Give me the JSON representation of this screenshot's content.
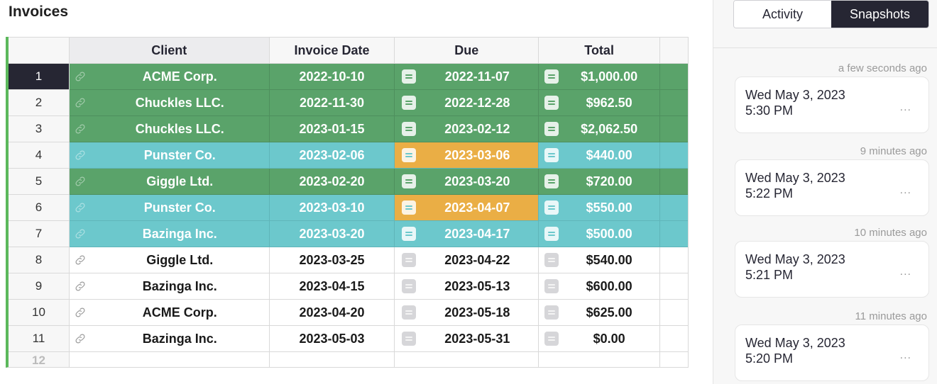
{
  "page": {
    "title": "Invoices"
  },
  "table": {
    "columns": [
      "Client",
      "Invoice Date",
      "Due",
      "Total"
    ],
    "rows": [
      {
        "num": "1",
        "client": "ACME Corp.",
        "date": "2022-10-10",
        "due": "2022-11-07",
        "total": "$1,000.00",
        "style": "green",
        "due_style": "",
        "selected": true
      },
      {
        "num": "2",
        "client": "Chuckles LLC.",
        "date": "2022-11-30",
        "due": "2022-12-28",
        "total": "$962.50",
        "style": "green",
        "due_style": ""
      },
      {
        "num": "3",
        "client": "Chuckles LLC.",
        "date": "2023-01-15",
        "due": "2023-02-12",
        "total": "$2,062.50",
        "style": "green",
        "due_style": ""
      },
      {
        "num": "4",
        "client": "Punster Co.",
        "date": "2023-02-06",
        "due": "2023-03-06",
        "total": "$440.00",
        "style": "teal",
        "due_style": "orange"
      },
      {
        "num": "5",
        "client": "Giggle Ltd.",
        "date": "2023-02-20",
        "due": "2023-03-20",
        "total": "$720.00",
        "style": "green",
        "due_style": ""
      },
      {
        "num": "6",
        "client": "Punster Co.",
        "date": "2023-03-10",
        "due": "2023-04-07",
        "total": "$550.00",
        "style": "teal",
        "due_style": "orange"
      },
      {
        "num": "7",
        "client": "Bazinga Inc.",
        "date": "2023-03-20",
        "due": "2023-04-17",
        "total": "$500.00",
        "style": "teal",
        "due_style": ""
      },
      {
        "num": "8",
        "client": "Giggle Ltd.",
        "date": "2023-03-25",
        "due": "2023-04-22",
        "total": "$540.00",
        "style": "white",
        "due_style": ""
      },
      {
        "num": "9",
        "client": "Bazinga Inc.",
        "date": "2023-04-15",
        "due": "2023-05-13",
        "total": "$600.00",
        "style": "white",
        "due_style": ""
      },
      {
        "num": "10",
        "client": "ACME Corp.",
        "date": "2023-04-20",
        "due": "2023-05-18",
        "total": "$625.00",
        "style": "white",
        "due_style": ""
      },
      {
        "num": "11",
        "client": "Bazinga Inc.",
        "date": "2023-05-03",
        "due": "2023-05-31",
        "total": "$0.00",
        "style": "white",
        "due_style": ""
      }
    ],
    "partial_row": {
      "num": "12"
    }
  },
  "colors": {
    "green_row": "#5aa36a",
    "teal_row": "#6cc8cc",
    "orange_cell": "#eaae45",
    "accent_dark": "#262633",
    "left_bar": "#5cb85c"
  },
  "sidebar": {
    "tabs": [
      {
        "label": "Activity",
        "active": false
      },
      {
        "label": "Snapshots",
        "active": true
      }
    ],
    "snapshots": [
      {
        "relative": "a few seconds ago",
        "line1": "Wed May 3, 2023",
        "line2": "5:30 PM"
      },
      {
        "relative": "9 minutes ago",
        "line1": "Wed May 3, 2023",
        "line2": "5:22 PM"
      },
      {
        "relative": "10 minutes ago",
        "line1": "Wed May 3, 2023",
        "line2": "5:21 PM"
      },
      {
        "relative": "11 minutes ago",
        "line1": "Wed May 3, 2023",
        "line2": "5:20 PM"
      }
    ],
    "menu_glyph": "..."
  }
}
